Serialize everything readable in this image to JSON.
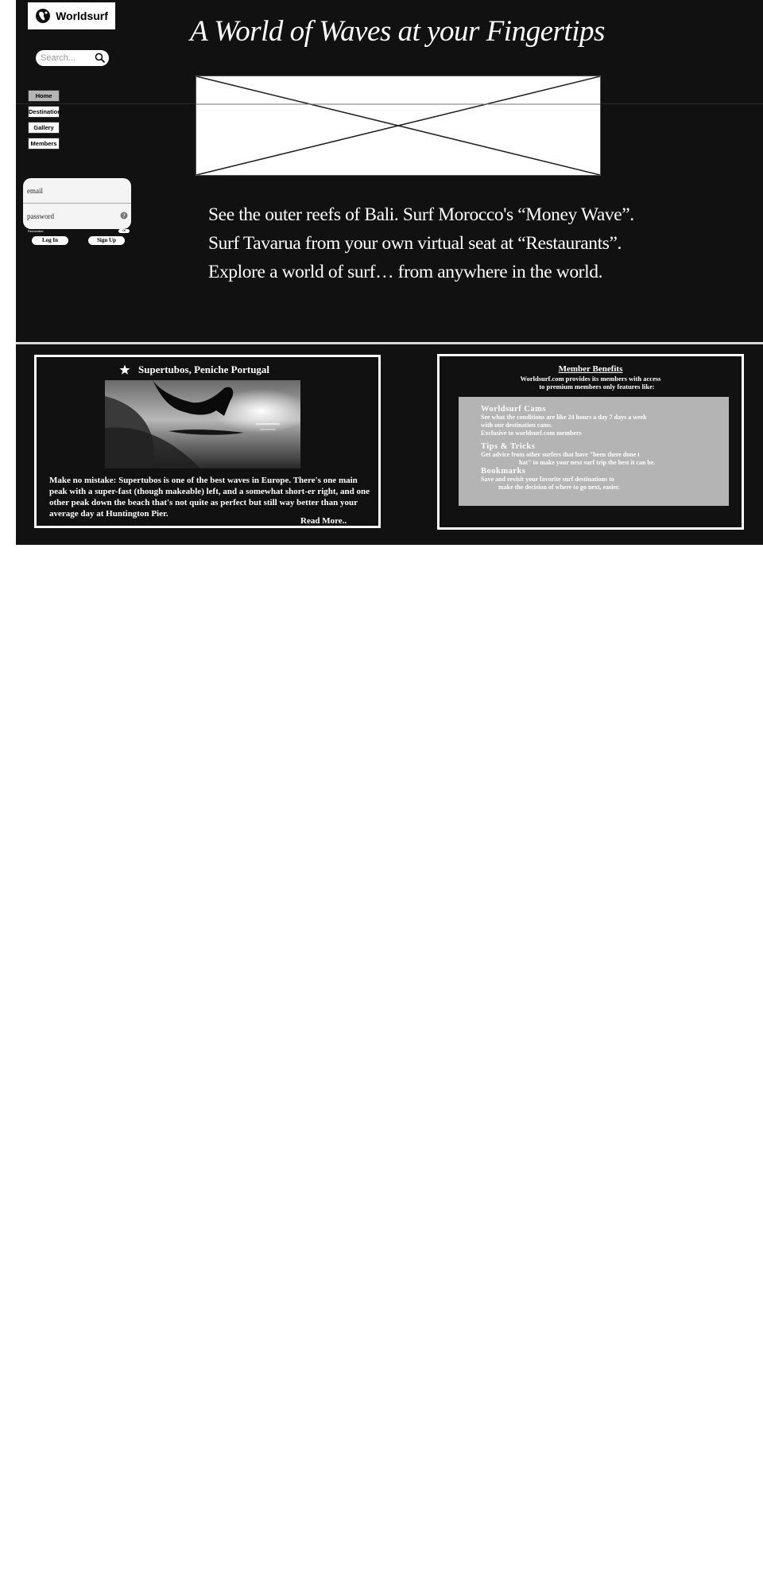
{
  "brand": {
    "name": "Worldsurf"
  },
  "search": {
    "placeholder": "Search..."
  },
  "nav": {
    "items": [
      {
        "label": "Home",
        "active": true
      },
      {
        "label": "Destination",
        "active": false
      },
      {
        "label": "Gallery",
        "active": false
      },
      {
        "label": "Members",
        "active": false
      }
    ]
  },
  "login": {
    "email_placeholder": "email",
    "password_placeholder": "password",
    "remember_label": "Remember",
    "remember_toggle": "Off",
    "login_button": "Log In",
    "signup_button": "Sign Up"
  },
  "hero": {
    "headline": "A World of Waves at your Fingertips",
    "intro_lines": [
      "See the outer reefs of Bali. Surf Morocco's “Money Wave”.",
      "Surf Tavarua from your own virtual seat at “Restaurants”.",
      "Explore a world of surf… from anywhere in the world."
    ]
  },
  "featured": {
    "title": "Supertubos, Peniche Portugal",
    "text": "Make no mistake: Supertubos is one of the best waves in Europe. There's one main peak with a super-fast (though makeable) left, and a somewhat short-er right, and one other peak down the beach that's not quite as perfect but still way better than your average day at Huntington Pier.",
    "read_more": "Read More.."
  },
  "benefits": {
    "title": "Member Benefits",
    "intro_line1": "Worldsurf.com provides its members with access",
    "intro_line2": "to premium members only features like:",
    "items": [
      {
        "heading": "Worldsurf Cams",
        "line1": "See what the conditions are like 24 hours a day 7 days a week",
        "line2": "with our destination cams.",
        "line3": "Exclusive to worldsurf.com members"
      },
      {
        "heading": "Tips & Tricks",
        "line1": "Get advice from other surfers that have \"been there done t",
        "line2": "hat\" to make your next surf trip the best it can be."
      },
      {
        "heading": "Bookmarks",
        "line1": "Save and revisit your favorite surf destinations to",
        "line2": "make the decision of where to go next, easier."
      }
    ]
  }
}
